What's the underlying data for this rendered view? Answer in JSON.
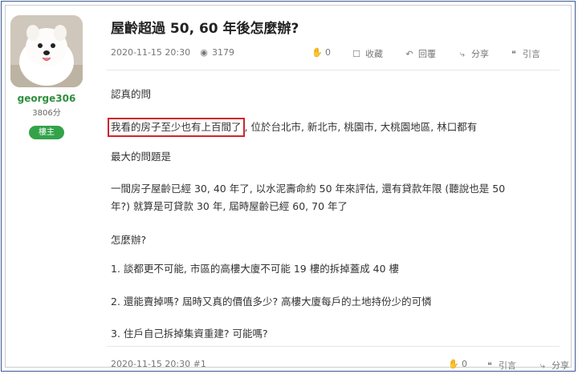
{
  "post": {
    "title": "屋齡超過 50, 60 年後怎麼辦?",
    "date": "2020-11-15 20:30",
    "views": "3179",
    "likes": "0",
    "collect_label": "收藏",
    "reply_label": "回覆",
    "share_label": "分享",
    "quote_label": "引言"
  },
  "author": {
    "username": "george306",
    "points": "3806分",
    "badge": "樓主"
  },
  "content": {
    "p1": "認真的問",
    "p2_highlight": "我看的房子至少也有上百間了",
    "p2_rest": ", 位於台北市, 新北市, 桃園市, 大桃園地區, 林口都有",
    "p3": "最大的問題是",
    "p4_line1": "一間房子屋齡已經 30, 40 年了, 以水泥壽命約 50 年來評估, 還有貸款年限 (聽說也是 50",
    "p4_line2": "年?) 就算是可貸款 30 年, 屆時屋齡已經 60, 70 年了",
    "p5": "怎麼辦?",
    "p6": "1. 談都更不可能, 市區的高樓大廈不可能 19 樓的拆掉蓋成 40 樓",
    "p7": "2. 還能賣掉嗎? 屆時又真的價值多少? 高樓大廈每戶的土地持份少的可憐",
    "p8": "3. 住戶自己拆掉集資重建? 可能嗎?"
  },
  "footer": {
    "date_floor": "2020-11-15 20:30 #1",
    "likes": "0",
    "quote_label": "引言",
    "share_label": "分享"
  },
  "icons": {
    "views": "eye-icon",
    "like": "clap-icon",
    "collect": "bookmark-icon",
    "reply": "reply-icon",
    "share": "share-icon",
    "quote": "quote-icon"
  },
  "colors": {
    "frame_border": "#3c5a96",
    "username": "#2f8f3c",
    "badge_bg": "#33a34a",
    "highlight_border": "#d2232a"
  }
}
